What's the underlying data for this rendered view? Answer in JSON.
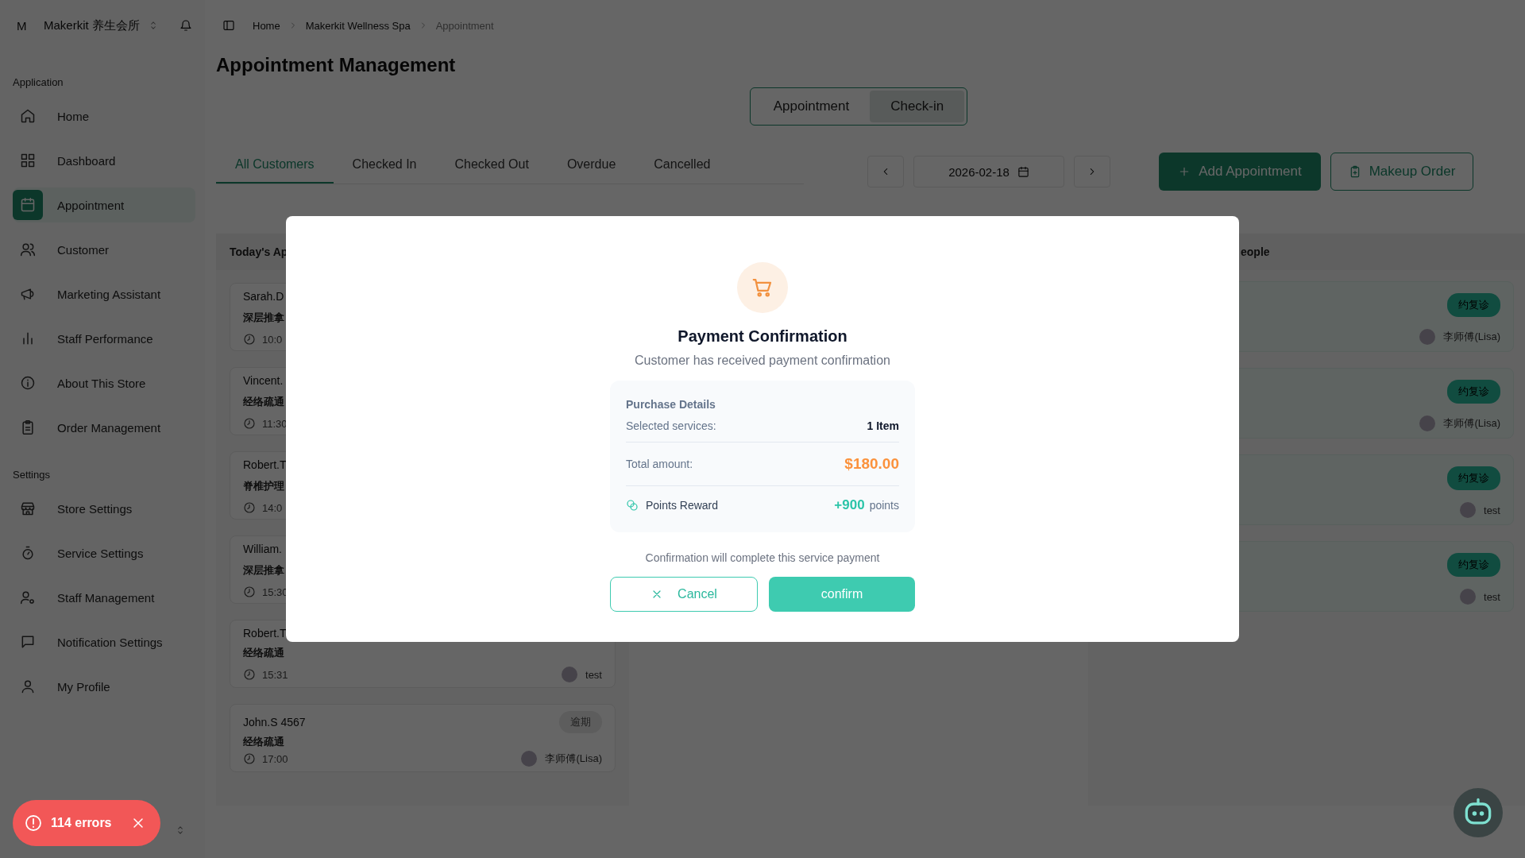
{
  "sidebar": {
    "org": {
      "avatar": "M",
      "name": "Makerkit 养生会所"
    },
    "sections": [
      {
        "label": "Application",
        "items": [
          {
            "label": "Home",
            "selected": false
          },
          {
            "label": "Dashboard",
            "selected": false
          },
          {
            "label": "Appointment",
            "selected": true
          },
          {
            "label": "Customer",
            "selected": false
          },
          {
            "label": "Marketing Assistant",
            "selected": false
          },
          {
            "label": "Staff Performance",
            "selected": false
          },
          {
            "label": "About This Store",
            "selected": false
          },
          {
            "label": "Order Management",
            "selected": false
          }
        ]
      },
      {
        "label": "Settings",
        "items": [
          {
            "label": "Store Settings",
            "selected": false
          },
          {
            "label": "Service Settings",
            "selected": false
          },
          {
            "label": "Staff Management",
            "selected": false
          },
          {
            "label": "Notification Settings",
            "selected": false
          },
          {
            "label": "My Profile",
            "selected": false
          }
        ]
      }
    ]
  },
  "breadcrumb": [
    {
      "label": "Home",
      "current": false
    },
    {
      "label": "Makerkit Wellness Spa",
      "current": false
    },
    {
      "label": "Appointment",
      "current": true
    }
  ],
  "page_title": "Appointment Management",
  "view_toggle": [
    {
      "label": "Appointment",
      "selected": false
    },
    {
      "label": "Check-in",
      "selected": true
    }
  ],
  "status_tabs": [
    {
      "label": "All Customers",
      "selected": true
    },
    {
      "label": "Checked In",
      "selected": false
    },
    {
      "label": "Checked Out",
      "selected": false
    },
    {
      "label": "Overdue",
      "selected": false
    },
    {
      "label": "Cancelled",
      "selected": false
    }
  ],
  "date_picker": {
    "value": "2026-02-18"
  },
  "actions": [
    {
      "label": "Add Appointment",
      "kind": "primary"
    },
    {
      "label": "Makeup Order",
      "kind": "outline"
    }
  ],
  "left_column": {
    "title": "Today's Ap",
    "cards": [
      {
        "name": "Sarah.D",
        "service": "深层推拿",
        "time": "10:0"
      },
      {
        "name": "Vincent.",
        "service": "经络疏通",
        "time": "11:30"
      },
      {
        "name": "Robert.T",
        "service": "脊椎护理",
        "time": "14:0"
      },
      {
        "name": "William.",
        "service": "深层推拿",
        "time": "15:30"
      },
      {
        "name": "Robert.T",
        "service": "经络疏通",
        "time": "15:31",
        "staff": "test"
      },
      {
        "name": "John.S 4567",
        "service": "经络疏通",
        "time": "17:00",
        "badge": "逾期",
        "staff": "李师傅(Lisa)"
      }
    ]
  },
  "right_column": {
    "title": "eople",
    "cards": [
      {
        "badge": "约复诊",
        "staff": "李师傅(Lisa)"
      },
      {
        "badge": "约复诊",
        "staff": "李师傅(Lisa)"
      },
      {
        "badge": "约复诊",
        "staff": "test"
      },
      {
        "badge": "约复诊",
        "staff": "test"
      }
    ]
  },
  "dialog": {
    "title": "Payment Confirmation",
    "subtitle": "Customer has received payment confirmation",
    "details_title": "Purchase Details",
    "rows": [
      {
        "kind": "plain",
        "label": "Selected services:",
        "value": "1 Item"
      },
      {
        "kind": "amount",
        "label": "Total amount:",
        "value": "$180.00"
      },
      {
        "kind": "points",
        "label": "Points Reward",
        "value": "+900",
        "unit": "points"
      }
    ],
    "note": "Confirmation will complete this service payment",
    "cancel": "Cancel",
    "confirm": "confirm"
  },
  "error_toast": {
    "label": "114 errors"
  }
}
